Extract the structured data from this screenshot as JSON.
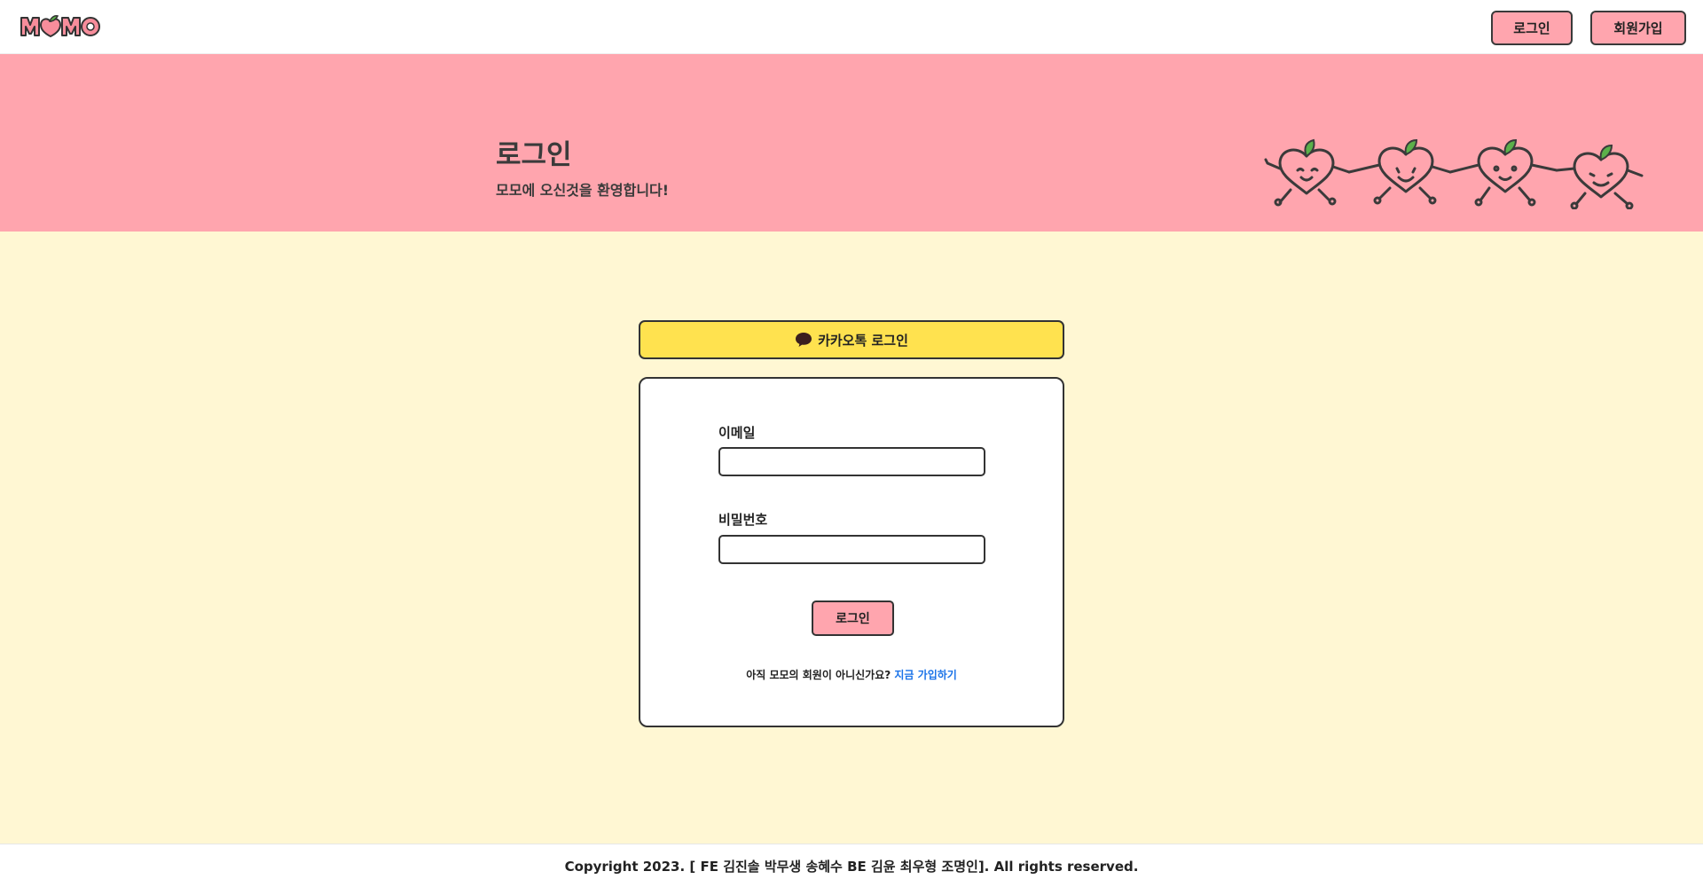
{
  "header": {
    "logo_text": "MOMO",
    "login_label": "로그인",
    "signup_label": "회원가입"
  },
  "banner": {
    "title": "로그인",
    "subtitle": "모모에 오신것을 환영합니다!"
  },
  "kakao": {
    "label": "카카오톡 로그인",
    "icon": "speech-bubble-icon"
  },
  "form": {
    "email_label": "이메일",
    "email_value": "",
    "password_label": "비밀번호",
    "password_value": "",
    "submit_label": "로그인",
    "signup_prompt": "아직 모모의 회원이 아니신가요?",
    "signup_link": "지금 가입하기"
  },
  "footer": {
    "text": "Copyright 2023. [ FE 김진솔 박무생 송혜수 BE 김윤 최우형 조명인]. All rights reserved."
  },
  "colors": {
    "pink": "#ffa5ae",
    "cream": "#fff7d3",
    "kakao_yellow": "#ffe24f",
    "link_blue": "#1a73e8"
  }
}
